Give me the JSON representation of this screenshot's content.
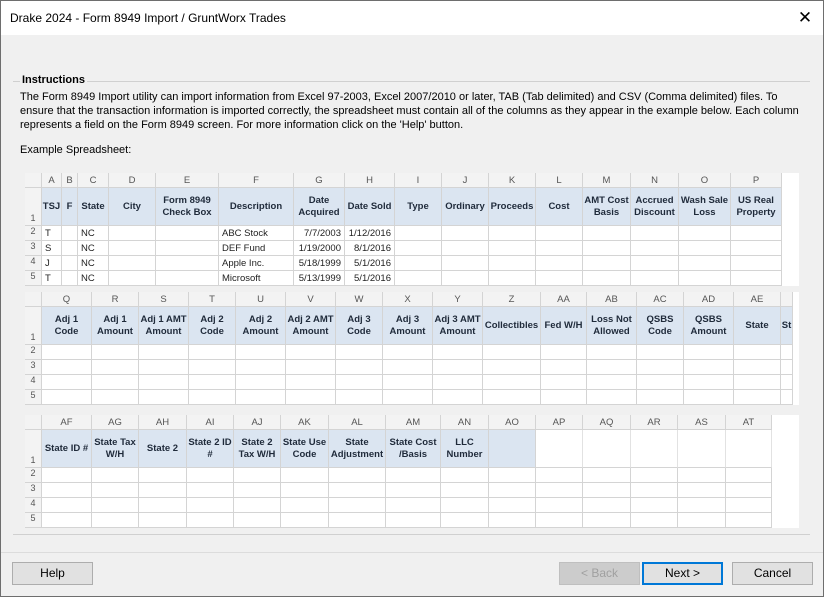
{
  "window": {
    "title": "Drake 2024 - Form 8949 Import / GruntWorx Trades",
    "close_glyph": "✕"
  },
  "instructions": {
    "heading": "Instructions",
    "text": "The Form 8949 Import utility can import information from Excel 97-2003, Excel 2007/2010 or later, TAB (Tab delimited) and CSV (Comma delimited) files. To ensure that the transaction information is imported correctly, the spreadsheet must contain all of the columns as they appear in the example below. Each column represents a field on the Form 8949 screen. For more information click on the 'Help' button.",
    "example_label": "Example Spreadsheet:"
  },
  "sheet1": {
    "letters": [
      "A",
      "B",
      "C",
      "D",
      "E",
      "F",
      "G",
      "H",
      "I",
      "J",
      "K",
      "L",
      "M",
      "N",
      "O",
      "P"
    ],
    "headers": [
      "TSJ",
      "F",
      "State",
      "City",
      "Form 8949 Check Box",
      "Description",
      "Date Acquired",
      "Date Sold",
      "Type",
      "Ordinary",
      "Proceeds",
      "Cost",
      "AMT Cost Basis",
      "Accrued Discount",
      "Wash Sale Loss",
      "US Real Property"
    ],
    "row_numbers": [
      "1",
      "2",
      "3",
      "4",
      "5"
    ],
    "rows": [
      {
        "tsj": "T",
        "f": "",
        "state": "NC",
        "city": "",
        "box": "",
        "desc": "ABC Stock",
        "acq": "7/7/2003",
        "sold": "1/12/2016"
      },
      {
        "tsj": "S",
        "f": "",
        "state": "NC",
        "city": "",
        "box": "",
        "desc": "DEF Fund",
        "acq": "1/19/2000",
        "sold": "8/1/2016"
      },
      {
        "tsj": "J",
        "f": "",
        "state": "NC",
        "city": "",
        "box": "",
        "desc": "Apple Inc.",
        "acq": "5/18/1999",
        "sold": "5/1/2016"
      },
      {
        "tsj": "T",
        "f": "",
        "state": "NC",
        "city": "",
        "box": "",
        "desc": "Microsoft",
        "acq": "5/13/1999",
        "sold": "5/1/2016"
      }
    ]
  },
  "sheet2": {
    "letters": [
      "Q",
      "R",
      "S",
      "T",
      "U",
      "V",
      "W",
      "X",
      "Y",
      "Z",
      "AA",
      "AB",
      "AC",
      "AD",
      "AE",
      ""
    ],
    "headers": [
      "Adj 1 Code",
      "Adj 1 Amount",
      "Adj 1 AMT Amount",
      "Adj 2 Code",
      "Adj 2 Amount",
      "Adj 2 AMT Amount",
      "Adj 3 Code",
      "Adj 3 Amount",
      "Adj 3 AMT Amount",
      "Collectibles",
      "Fed W/H",
      "Loss Not Allowed",
      "QSBS Code",
      "QSBS Amount",
      "State",
      "St"
    ],
    "row_numbers": [
      "1",
      "2",
      "3",
      "4",
      "5"
    ]
  },
  "sheet3": {
    "letters": [
      "AF",
      "AG",
      "AH",
      "AI",
      "AJ",
      "AK",
      "AL",
      "AM",
      "AN",
      "AO",
      "AP",
      "AQ",
      "AR",
      "AS",
      "AT"
    ],
    "headers": [
      "State ID #",
      "State Tax W/H",
      "State 2",
      "State 2 ID #",
      "State 2 Tax W/H",
      "State Use Code",
      "State Adjustment",
      "State Cost /Basis",
      "LLC Number",
      "",
      "",
      "",
      "",
      "",
      ""
    ],
    "row_numbers": [
      "1",
      "2",
      "3",
      "4",
      "5"
    ]
  },
  "buttons": {
    "help": "Help",
    "back": "< Back",
    "next": "Next >",
    "cancel": "Cancel"
  }
}
